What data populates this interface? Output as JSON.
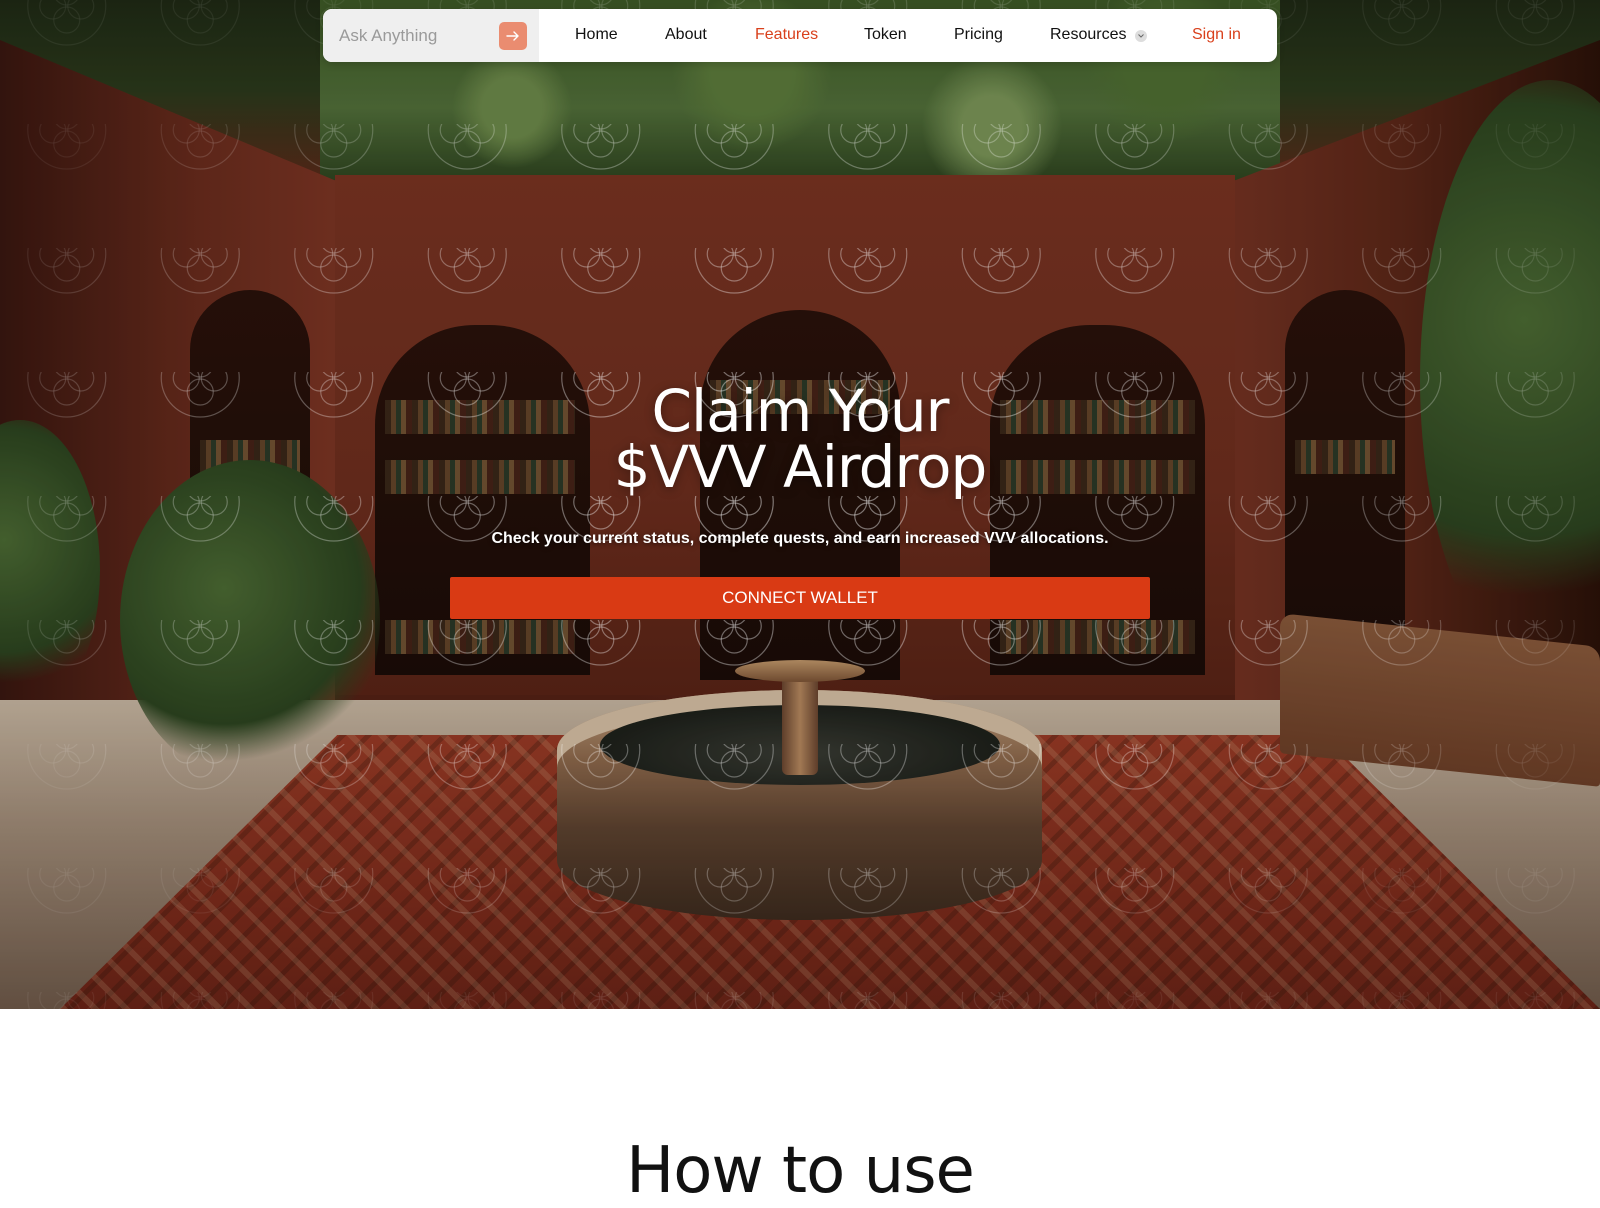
{
  "nav": {
    "search_placeholder": "Ask Anything",
    "items": [
      {
        "label": "Home"
      },
      {
        "label": "About"
      },
      {
        "label": "Features"
      },
      {
        "label": "Token"
      },
      {
        "label": "Pricing"
      },
      {
        "label": "Resources"
      },
      {
        "label": "Sign in"
      }
    ],
    "icons": {
      "submit": "arrow-right-icon",
      "resources": "chevron-down-icon"
    }
  },
  "hero": {
    "title_line1": "Claim Your",
    "title_line2": "$VVV Airdrop",
    "subtitle": "Check your current status, complete quests, and earn increased VVV allocations.",
    "cta_label": "CONNECT WALLET"
  },
  "section": {
    "title": "How to use"
  },
  "colors": {
    "accent": "#d9401c",
    "cta": "#d93a14",
    "search_button": "#ea8c70"
  }
}
